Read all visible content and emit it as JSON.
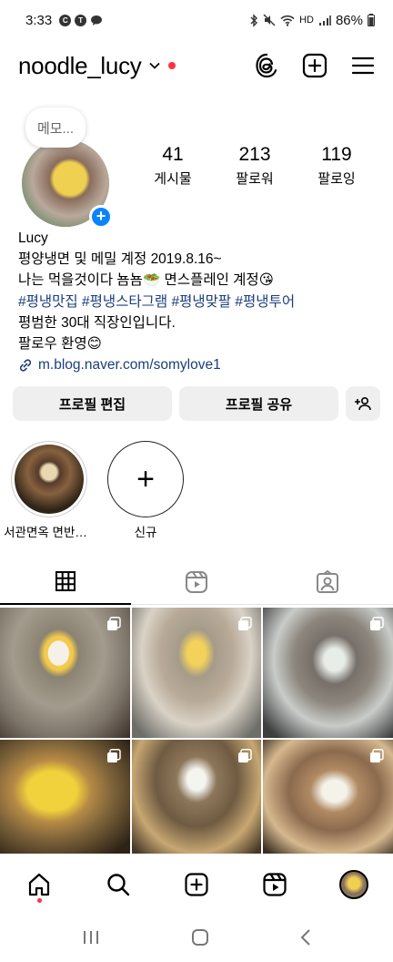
{
  "status_bar": {
    "time": "3:33",
    "left_icons": [
      "c-badge-icon",
      "talk-badge-icon",
      "chat-icon"
    ],
    "network": "HD",
    "battery": "86%"
  },
  "header": {
    "username": "noodle_lucy",
    "dot_color": "#ff3040"
  },
  "profile": {
    "memo": "메모...",
    "stats": [
      {
        "value": "41",
        "label": "게시물"
      },
      {
        "value": "213",
        "label": "팔로워"
      },
      {
        "value": "119",
        "label": "팔로잉"
      }
    ],
    "name": "Lucy",
    "bio_lines": [
      "평양냉면 및 메밀 계정 2019.8.16~",
      "나는 먹을것이다 뇸뇸🥗 면스플레인 계정😘",
      "#평냉맛집 #평냉스타그램 #평냉맞팔 #평냉투어",
      "평범한 30대 직장인입니다.",
      "팔로우 환영😊"
    ],
    "link": "m.blog.naver.com/somylove1"
  },
  "buttons": {
    "edit": "프로필 편집",
    "share": "프로필 공유"
  },
  "highlights": [
    {
      "label": "서관면옥 면반…"
    },
    {
      "label": "신규"
    }
  ],
  "colors": {
    "accent": "#0a84ff",
    "tag": "#1b3e7a",
    "button_bg": "#efefef"
  }
}
